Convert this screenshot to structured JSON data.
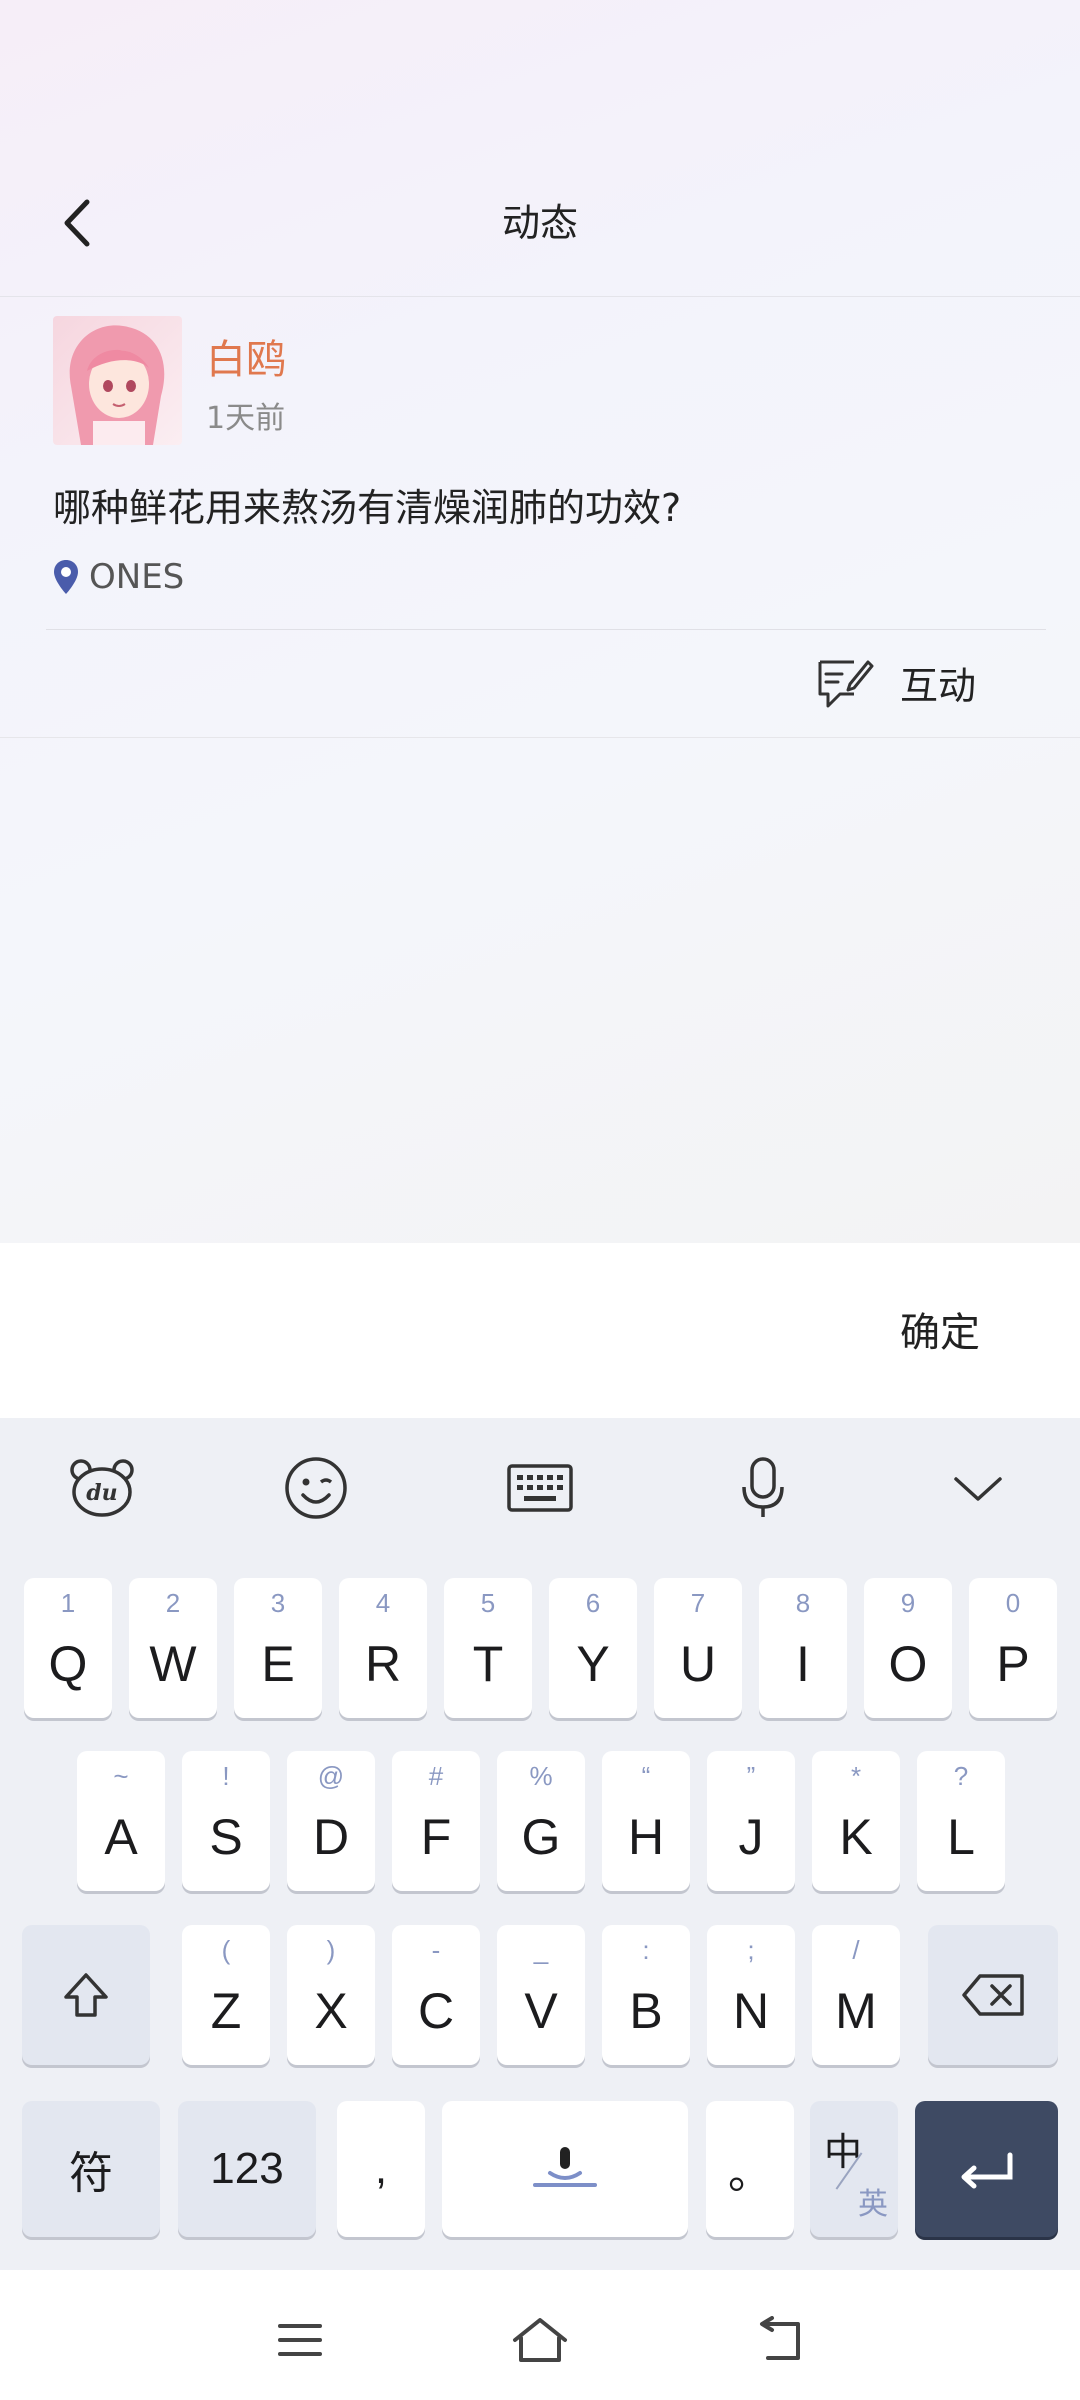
{
  "header": {
    "title": "动态"
  },
  "post": {
    "username": "白鸥",
    "time": "1天前",
    "text": "哪种鲜花用来熬汤有清燥润肺的功效?",
    "location": "ONES",
    "interact_label": "互动"
  },
  "input_bar": {
    "confirm_label": "确定"
  },
  "keyboard": {
    "toolbar": [
      "du-bear-icon",
      "emoji-icon",
      "keyboard-icon",
      "microphone-icon",
      "collapse-chevron-icon"
    ],
    "row1": [
      {
        "k": "Q",
        "s": "1"
      },
      {
        "k": "W",
        "s": "2"
      },
      {
        "k": "E",
        "s": "3"
      },
      {
        "k": "R",
        "s": "4"
      },
      {
        "k": "T",
        "s": "5"
      },
      {
        "k": "Y",
        "s": "6"
      },
      {
        "k": "U",
        "s": "7"
      },
      {
        "k": "I",
        "s": "8"
      },
      {
        "k": "O",
        "s": "9"
      },
      {
        "k": "P",
        "s": "0"
      }
    ],
    "row2": [
      {
        "k": "A",
        "s": "~"
      },
      {
        "k": "S",
        "s": "!"
      },
      {
        "k": "D",
        "s": "@"
      },
      {
        "k": "F",
        "s": "#"
      },
      {
        "k": "G",
        "s": "%"
      },
      {
        "k": "H",
        "s": "“"
      },
      {
        "k": "J",
        "s": "”"
      },
      {
        "k": "K",
        "s": "*"
      },
      {
        "k": "L",
        "s": "?"
      }
    ],
    "row3": [
      {
        "k": "Z",
        "s": "("
      },
      {
        "k": "X",
        "s": ")"
      },
      {
        "k": "C",
        "s": "-"
      },
      {
        "k": "V",
        "s": "_"
      },
      {
        "k": "B",
        "s": ":"
      },
      {
        "k": "N",
        "s": ";"
      },
      {
        "k": "M",
        "s": "/"
      }
    ],
    "symbols_label": "符",
    "numbers_label": "123",
    "comma_label": ",",
    "period_label": "。",
    "lang_zh": "中",
    "lang_en": "英"
  }
}
